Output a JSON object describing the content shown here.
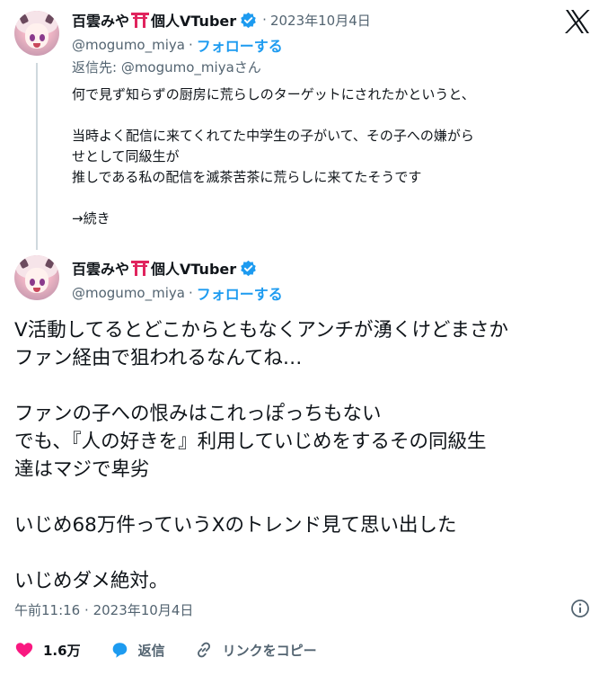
{
  "reply_tweet": {
    "author": {
      "display_name": "百雲みや",
      "display_name_suffix": "個人VTuber",
      "handle": "@mogumo_miya",
      "date": "2023年10月4日",
      "follow_label": "フォローする"
    },
    "reply_to": "返信先: @mogumo_miyaさん",
    "lines": [
      "何で見ず知らずの厨房に荒らしのターゲットにされたかというと、",
      "",
      "当時よく配信に来てくれてた中学生の子がいて、その子への嫌がら",
      "せとして同級生が",
      "推しである私の配信を滅茶苦茶に荒らしに来てたそうです",
      "",
      "→続き"
    ]
  },
  "main_tweet": {
    "author": {
      "display_name": "百雲みや",
      "display_name_suffix": "個人VTuber",
      "handle": "@mogumo_miya",
      "follow_label": "フォローする"
    },
    "lines": [
      "V活動してるとどこからともなくアンチが湧くけどまさか",
      "ファン経由で狙われるなんてね…",
      "",
      "ファンの子への恨みはこれっぽっちもない",
      "でも、『人の好きを』利用していじめをするその同級生",
      "達はマジで卑劣",
      "",
      "いじめ68万件っていうXのトレンド見て思い出した",
      "",
      "いじめダメ絶対。"
    ],
    "time": "午前11:16",
    "date": "2023年10月4日"
  },
  "actions": {
    "like_count": "1.6万",
    "reply_label": "返信",
    "copy_link_label": "リンクをコピー"
  },
  "icons": {
    "logo": "x-logo-icon",
    "verified": "verified-badge-icon",
    "torii": "torii-gate-icon",
    "info": "info-icon",
    "like": "heart-icon",
    "reply": "reply-bubble-icon",
    "link": "link-icon"
  },
  "colors": {
    "link": "#1d9bf0",
    "verified": "#1d9bf0",
    "like": "#f91880",
    "muted_text": "#536471",
    "text": "#0f1419",
    "thread_line": "#cfd9de",
    "torii": "#e0245e"
  }
}
